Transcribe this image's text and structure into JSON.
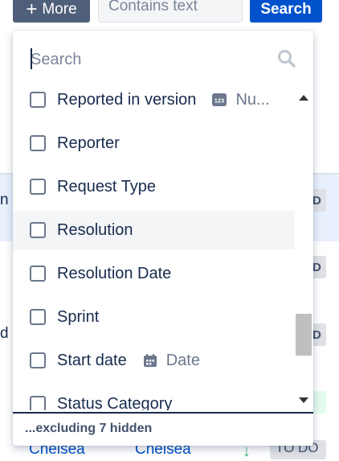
{
  "toolbar": {
    "more_label": "More",
    "contains_placeholder": "Contains text",
    "search_label": "Search"
  },
  "background": {
    "frag_n": "n",
    "frag_d": "d",
    "lozenge_1": "D",
    "lozenge_2": "D",
    "lozenge_3": "D",
    "bottom_assignee": "Chelsea",
    "bottom_reporter": "Chelsea",
    "bottom_status": "TO DO"
  },
  "dropdown": {
    "search_placeholder": "Search",
    "items": [
      {
        "label": "Reported in version",
        "type_label": "Nu...",
        "type_icon": "number-icon"
      },
      {
        "label": "Reporter"
      },
      {
        "label": "Request Type"
      },
      {
        "label": "Resolution"
      },
      {
        "label": "Resolution Date"
      },
      {
        "label": "Sprint"
      },
      {
        "label": "Start date",
        "type_label": "Date",
        "type_icon": "calendar-icon"
      },
      {
        "label": "Status Category"
      }
    ],
    "footer": "...excluding 7 hidden"
  },
  "colors": {
    "primary": "#0052cc",
    "more_button": "#505f79",
    "hover_row": "#f4f5f7",
    "row_highlight": "#e8f0fd"
  }
}
